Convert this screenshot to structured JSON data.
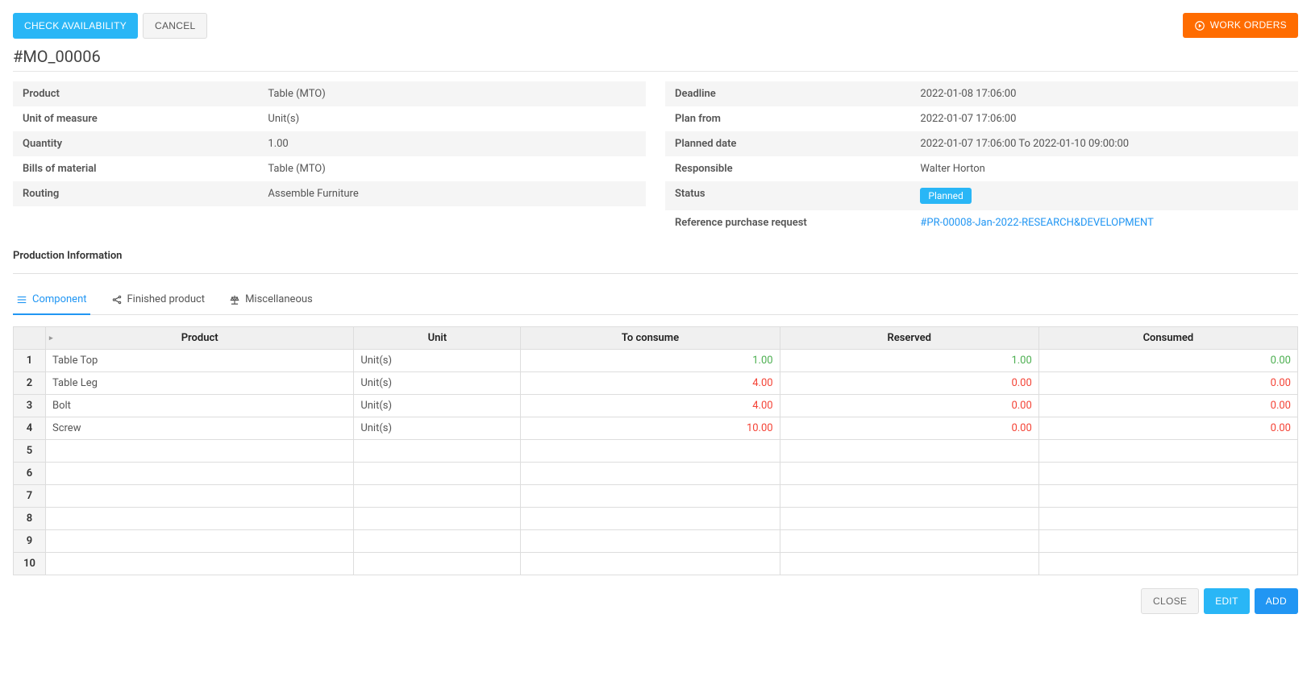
{
  "header": {
    "check_availability": "CHECK AVAILABILITY",
    "cancel": "CANCEL",
    "work_orders": "WORK ORDERS",
    "title": "#MO_00006"
  },
  "details_left": [
    {
      "label": "Product",
      "value": "Table (MTO)"
    },
    {
      "label": "Unit of measure",
      "value": "Unit(s)"
    },
    {
      "label": "Quantity",
      "value": "1.00"
    },
    {
      "label": "Bills of material",
      "value": "Table (MTO)"
    },
    {
      "label": "Routing",
      "value": "Assemble Furniture"
    }
  ],
  "details_right": [
    {
      "label": "Deadline",
      "value": "2022-01-08 17:06:00",
      "type": "text"
    },
    {
      "label": "Plan from",
      "value": "2022-01-07 17:06:00",
      "type": "text"
    },
    {
      "label": "Planned date",
      "value": "2022-01-07 17:06:00 To 2022-01-10 09:00:00",
      "type": "text"
    },
    {
      "label": "Responsible",
      "value": "Walter Horton",
      "type": "text"
    },
    {
      "label": "Status",
      "value": "Planned",
      "type": "badge"
    },
    {
      "label": "Reference purchase request",
      "value": "#PR-00008-Jan-2022-RESEARCH&DEVELOPMENT",
      "type": "link"
    }
  ],
  "section_title": "Production Information",
  "tabs": [
    {
      "label": "Component",
      "active": true,
      "icon": "list"
    },
    {
      "label": "Finished product",
      "active": false,
      "icon": "share"
    },
    {
      "label": "Miscellaneous",
      "active": false,
      "icon": "balance"
    }
  ],
  "table": {
    "headers": [
      "Product",
      "Unit",
      "To consume",
      "Reserved",
      "Consumed"
    ],
    "rows": [
      {
        "n": 1,
        "product": "Table Top",
        "unit": "Unit(s)",
        "to_consume": "1.00",
        "reserved": "1.00",
        "consumed": "0.00",
        "color": "green"
      },
      {
        "n": 2,
        "product": "Table Leg",
        "unit": "Unit(s)",
        "to_consume": "4.00",
        "reserved": "0.00",
        "consumed": "0.00",
        "color": "red"
      },
      {
        "n": 3,
        "product": "Bolt",
        "unit": "Unit(s)",
        "to_consume": "4.00",
        "reserved": "0.00",
        "consumed": "0.00",
        "color": "red"
      },
      {
        "n": 4,
        "product": "Screw",
        "unit": "Unit(s)",
        "to_consume": "10.00",
        "reserved": "0.00",
        "consumed": "0.00",
        "color": "red"
      },
      {
        "n": 5
      },
      {
        "n": 6
      },
      {
        "n": 7
      },
      {
        "n": 8
      },
      {
        "n": 9
      },
      {
        "n": 10
      }
    ]
  },
  "footer": {
    "close": "CLOSE",
    "edit": "EDIT",
    "add": "ADD"
  }
}
